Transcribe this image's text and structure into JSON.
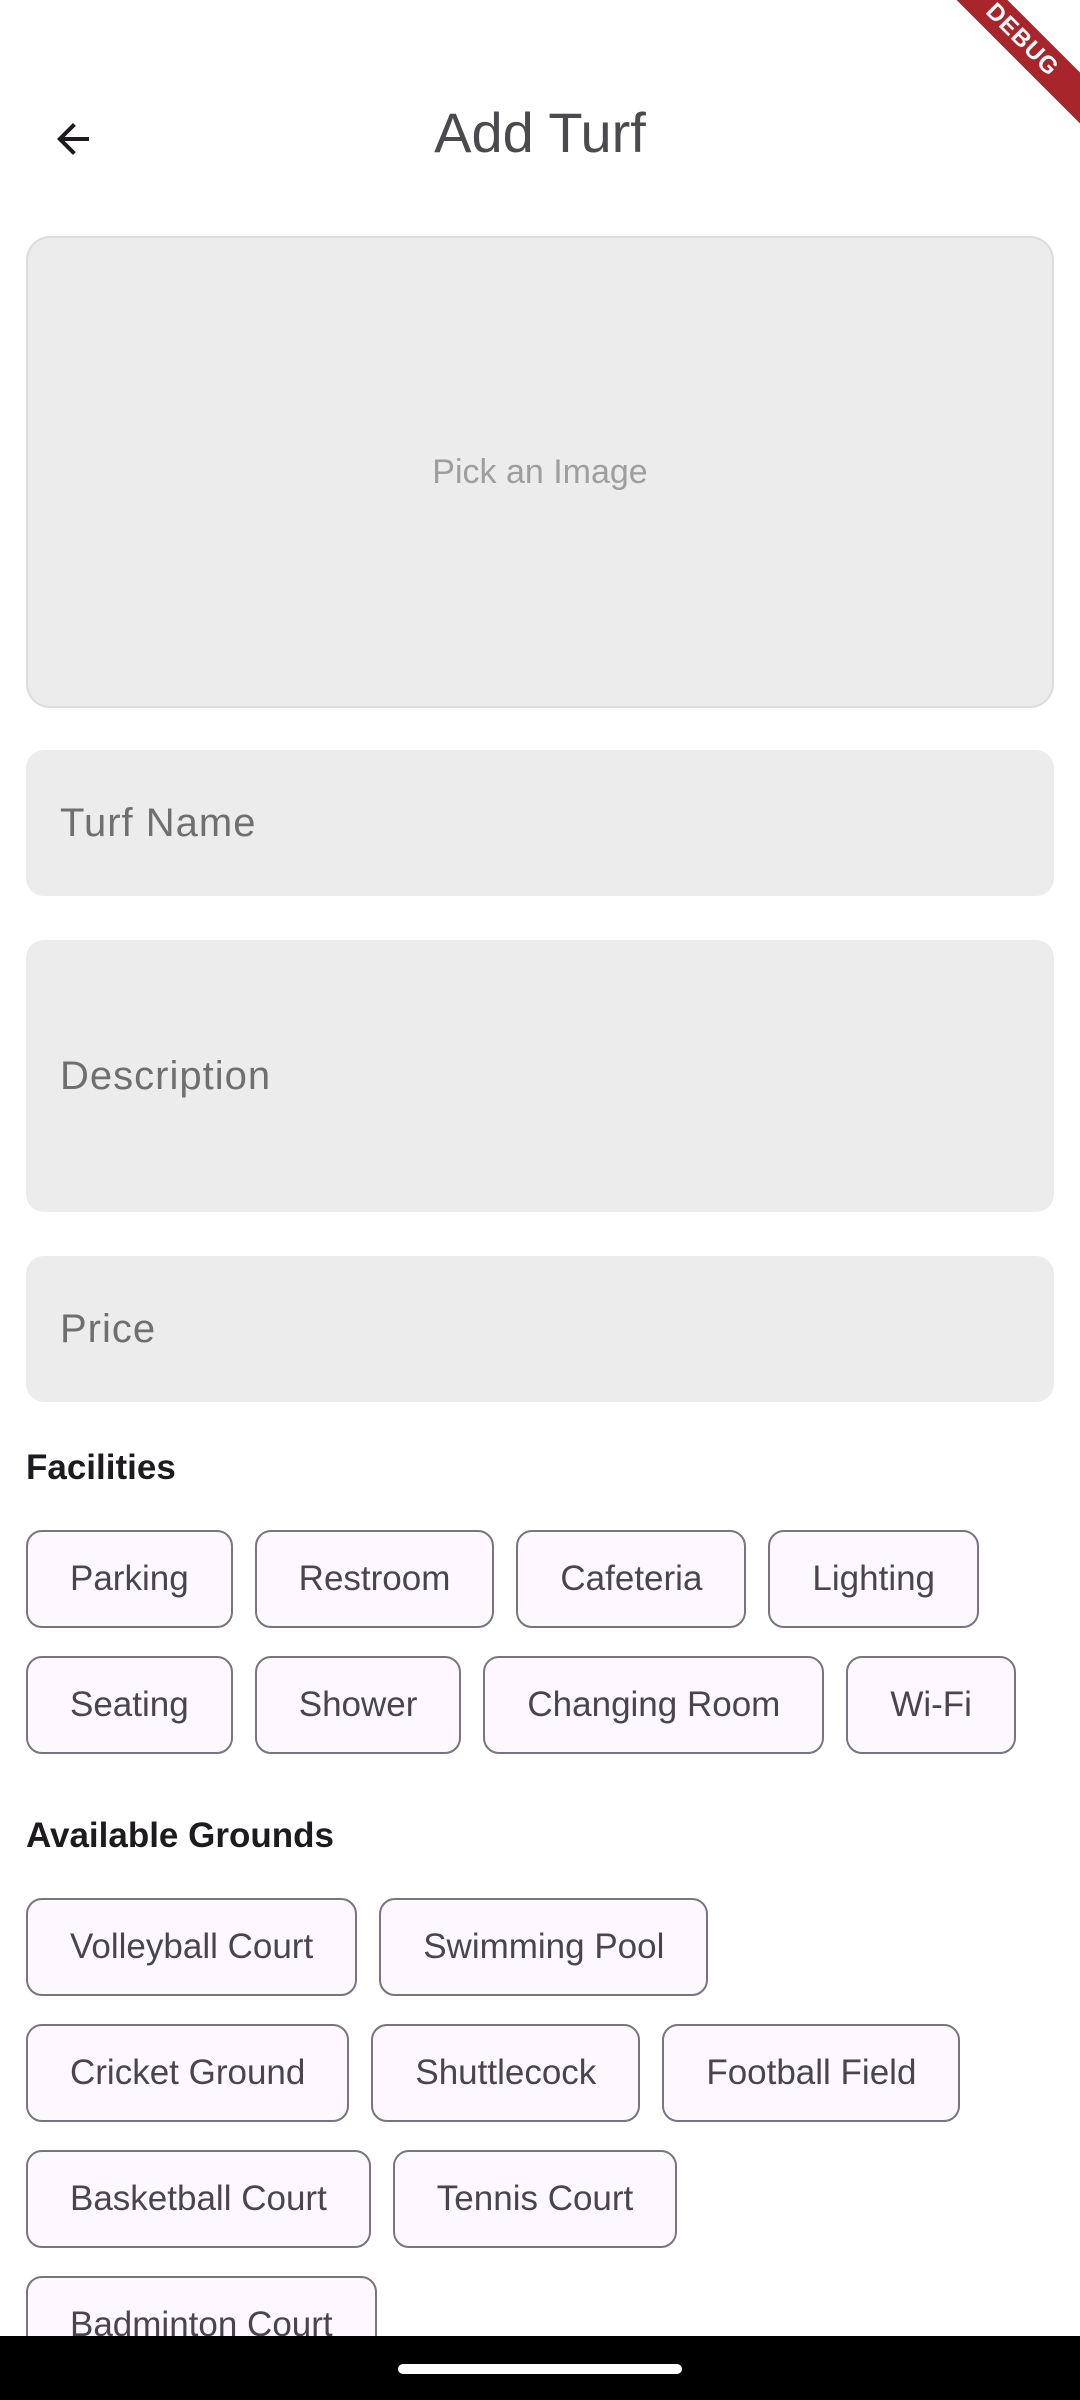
{
  "header": {
    "title": "Add Turf",
    "debug_label": "DEBUG"
  },
  "image_picker": {
    "label": "Pick an Image"
  },
  "form": {
    "turf_name_placeholder": "Turf Name",
    "description_placeholder": "Description",
    "price_placeholder": "Price"
  },
  "facilities": {
    "title": "Facilities",
    "chips": [
      "Parking",
      "Restroom",
      "Cafeteria",
      "Lighting",
      "Seating",
      "Shower",
      "Changing Room",
      "Wi-Fi"
    ]
  },
  "grounds": {
    "title": "Available Grounds",
    "chips": [
      "Volleyball Court",
      "Swimming Pool",
      "Cricket Ground",
      "Shuttlecock",
      "Football Field",
      "Basketball Court",
      "Tennis Court",
      "Badminton Court"
    ]
  },
  "colors": {
    "chip_background": "#fdf7ff",
    "chip_border": "#79747e",
    "field_background": "#ececec",
    "debug_banner": "#a8262b"
  }
}
